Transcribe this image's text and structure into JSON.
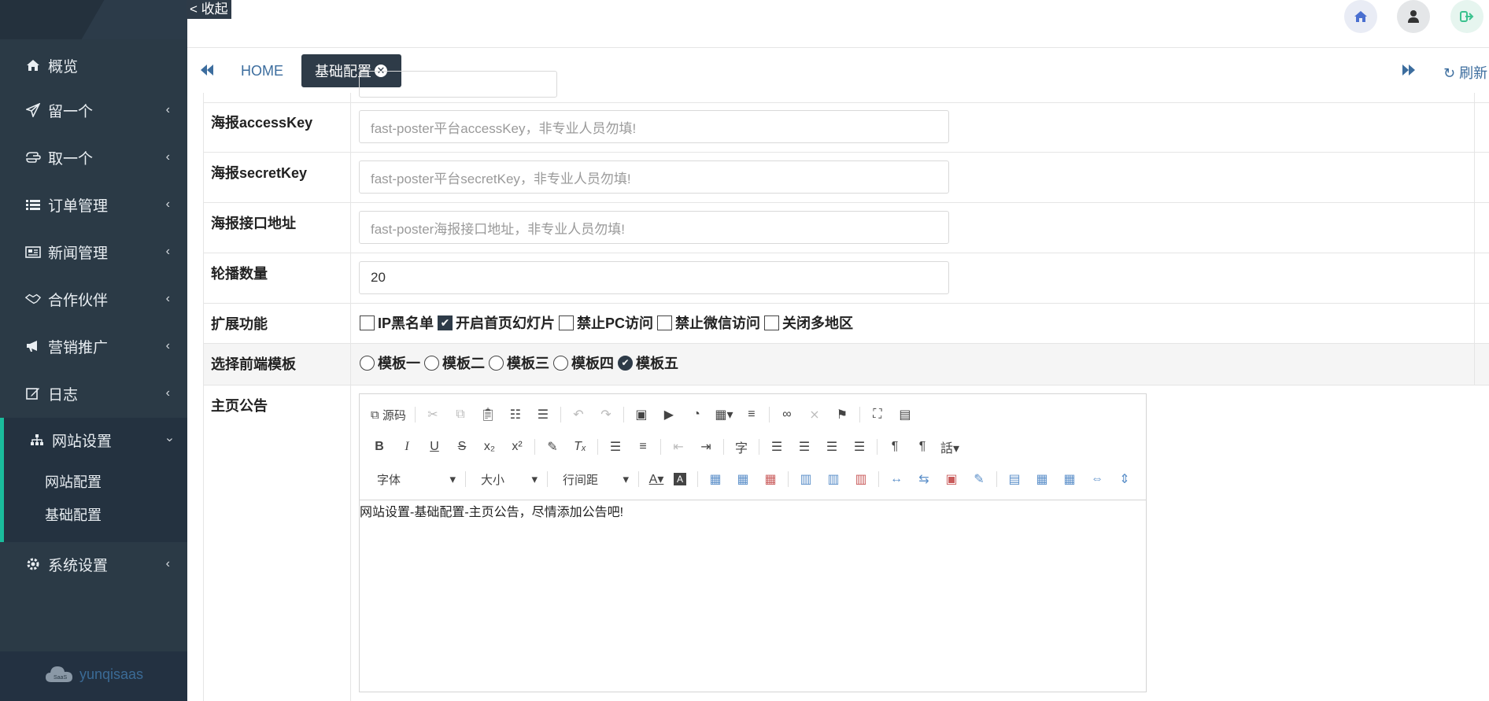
{
  "sidebar": {
    "items": [
      {
        "label": "概览",
        "icon": "home-icon",
        "top": 0
      },
      {
        "label": "留一个",
        "icon": "paper-plane-icon"
      },
      {
        "label": "取一个",
        "icon": "hand-icon"
      },
      {
        "label": "订单管理",
        "icon": "list-icon"
      },
      {
        "label": "新闻管理",
        "icon": "newspaper-icon"
      },
      {
        "label": "合作伙伴",
        "icon": "handshake-icon"
      },
      {
        "label": "营销推广",
        "icon": "bullhorn-icon"
      },
      {
        "label": "日志",
        "icon": "edit-icon"
      },
      {
        "label": "网站设置",
        "icon": "sitemap-icon"
      },
      {
        "label": "系统设置",
        "icon": "gear-icon"
      }
    ],
    "subitems": [
      "网站配置",
      "基础配置"
    ],
    "footer_brand": "yunqisaas",
    "footer_logo_text": "SaaS"
  },
  "topbar": {
    "collapse_label": "< 收起"
  },
  "tabs": {
    "home_label": "HOME",
    "active_label": "基础配置",
    "refresh_label": "刷新"
  },
  "form": {
    "access_key": {
      "label": "海报accessKey",
      "placeholder": "fast-poster平台accessKey，非专业人员勿填!"
    },
    "secret_key": {
      "label": "海报secretKey",
      "placeholder": "fast-poster平台secretKey，非专业人员勿填!"
    },
    "api_url": {
      "label": "海报接口地址",
      "placeholder": "fast-poster海报接口地址，非专业人员勿填!"
    },
    "carousel_count": {
      "label": "轮播数量",
      "value": "20"
    },
    "extensions": {
      "label": "扩展功能",
      "options": [
        {
          "label": "IP黑名单",
          "checked": false
        },
        {
          "label": "开启首页幻灯片",
          "checked": true
        },
        {
          "label": "禁止PC访问",
          "checked": false
        },
        {
          "label": "禁止微信访问",
          "checked": false
        },
        {
          "label": "关闭多地区",
          "checked": false
        }
      ]
    },
    "template": {
      "label": "选择前端模板",
      "options": [
        {
          "label": "模板一",
          "checked": false
        },
        {
          "label": "模板二",
          "checked": false
        },
        {
          "label": "模板三",
          "checked": false
        },
        {
          "label": "模板四",
          "checked": false
        },
        {
          "label": "模板五",
          "checked": true
        }
      ]
    },
    "notice": {
      "label": "主页公告",
      "content": "网站设置-基础配置-主页公告，尽情添加公告吧!",
      "toolbar": {
        "source_label": "源码",
        "font_label": "字体",
        "size_label": "大小",
        "line_height_label": "行间距"
      }
    }
  },
  "colors": {
    "sidebar_bg": "#2b3a46",
    "accent_green": "#1abc9c",
    "tab_active_bg": "#2e3b48",
    "link_blue": "#3c6d9e"
  }
}
